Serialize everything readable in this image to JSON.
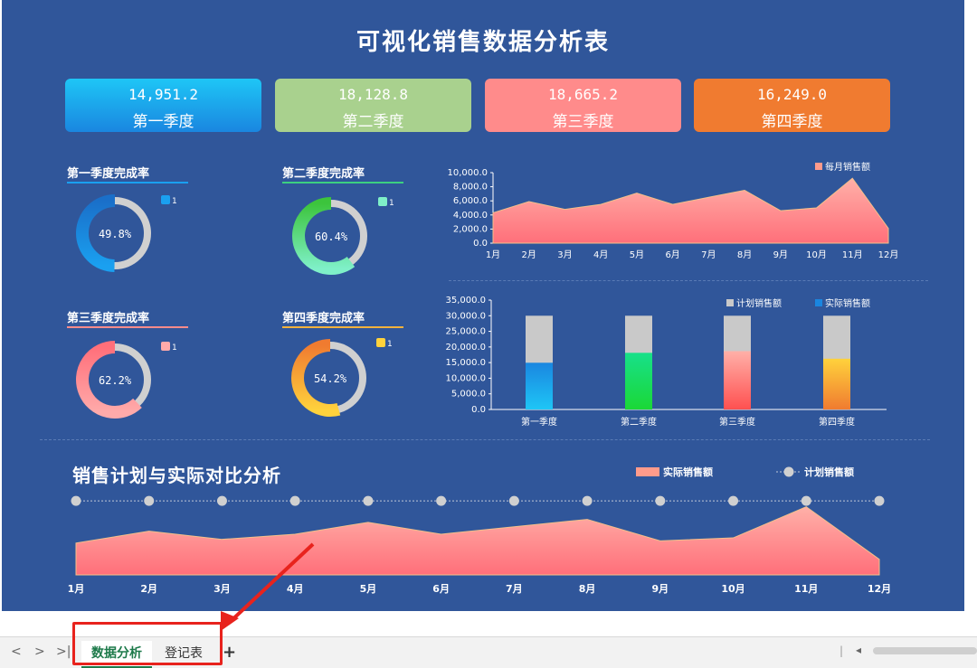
{
  "dashboard": {
    "title": "可视化销售数据分析表",
    "quarters": [
      {
        "value": "14,951.2",
        "label": "第一季度",
        "color_top": "#1ec6f6",
        "color_bottom": "#1a86e0"
      },
      {
        "value": "18,128.8",
        "label": "第二季度",
        "color_top": "#a9d18e",
        "color_bottom": "#a9d18e"
      },
      {
        "value": "18,665.2",
        "label": "第三季度",
        "color_top": "#ff8b8b",
        "color_bottom": "#ff8b8b"
      },
      {
        "value": "16,249.0",
        "label": "第四季度",
        "color_top": "#f07b30",
        "color_bottom": "#f07b30"
      }
    ],
    "rates": [
      {
        "title": "第一季度完成率",
        "label": "49.8%",
        "value": 0.498,
        "color_a": "#1aa0f0",
        "color_b": "#1a6fc9",
        "legend": "1"
      },
      {
        "title": "第二季度完成率",
        "label": "60.4%",
        "value": 0.604,
        "color_a": "#7ff0c8",
        "color_b": "#3cc43c",
        "legend": "1"
      },
      {
        "title": "第三季度完成率",
        "label": "62.2%",
        "value": 0.622,
        "color_a": "#ffaaaa",
        "color_b": "#ff6f7a",
        "legend": "1"
      },
      {
        "title": "第四季度完成率",
        "label": "54.2%",
        "value": 0.542,
        "color_a": "#ffd23c",
        "color_b": "#f07b30",
        "legend": "1"
      }
    ]
  },
  "chart_data": [
    {
      "type": "area",
      "categories": [
        "1月",
        "2月",
        "3月",
        "4月",
        "5月",
        "6月",
        "7月",
        "8月",
        "9月",
        "10月",
        "11月",
        "12月"
      ],
      "series": [
        {
          "name": "每月销售额",
          "values": [
            4300,
            5900,
            4800,
            5500,
            7100,
            5500,
            6500,
            7500,
            4600,
            5000,
            9200,
            2100
          ]
        }
      ],
      "ylim": [
        0,
        10000
      ],
      "yticks": [
        "0.0",
        "2,000.0",
        "4,000.0",
        "6,000.0",
        "8,000.0",
        "10,000.0"
      ],
      "legend": "top-right"
    },
    {
      "type": "bar",
      "categories": [
        "第一季度",
        "第二季度",
        "第三季度",
        "第四季度"
      ],
      "series": [
        {
          "name": "计划销售额",
          "values": [
            30000,
            30000,
            30000,
            30000
          ]
        },
        {
          "name": "实际销售额",
          "values": [
            14951.2,
            18128.8,
            18665.2,
            16249.0
          ]
        }
      ],
      "ylim": [
        0,
        35000
      ],
      "yticks": [
        "0.0",
        "5,000.0",
        "10,000.0",
        "15,000.0",
        "20,000.0",
        "25,000.0",
        "30,000.0",
        "35,000.0"
      ],
      "legend": "top-right"
    },
    {
      "type": "area",
      "title": "销售计划与实际对比分析",
      "categories": [
        "1月",
        "2月",
        "3月",
        "4月",
        "5月",
        "6月",
        "7月",
        "8月",
        "9月",
        "10月",
        "11月",
        "12月"
      ],
      "series": [
        {
          "name": "实际销售额",
          "values": [
            4300,
            5900,
            4800,
            5500,
            7100,
            5500,
            6500,
            7500,
            4600,
            5000,
            9200,
            2100
          ]
        },
        {
          "name": "计划销售额",
          "values": [
            10000,
            10000,
            10000,
            10000,
            10000,
            10000,
            10000,
            10000,
            10000,
            10000,
            10000,
            10000
          ]
        }
      ],
      "ylim": [
        0,
        10500
      ],
      "legend": "top-right"
    }
  ],
  "sheet_tabs": {
    "nav": [
      "<",
      ">",
      ">|"
    ],
    "tabs": [
      "数据分析",
      "登记表"
    ],
    "add": "+"
  },
  "hscroll": {
    "left": "|",
    "arrow": "◂"
  }
}
